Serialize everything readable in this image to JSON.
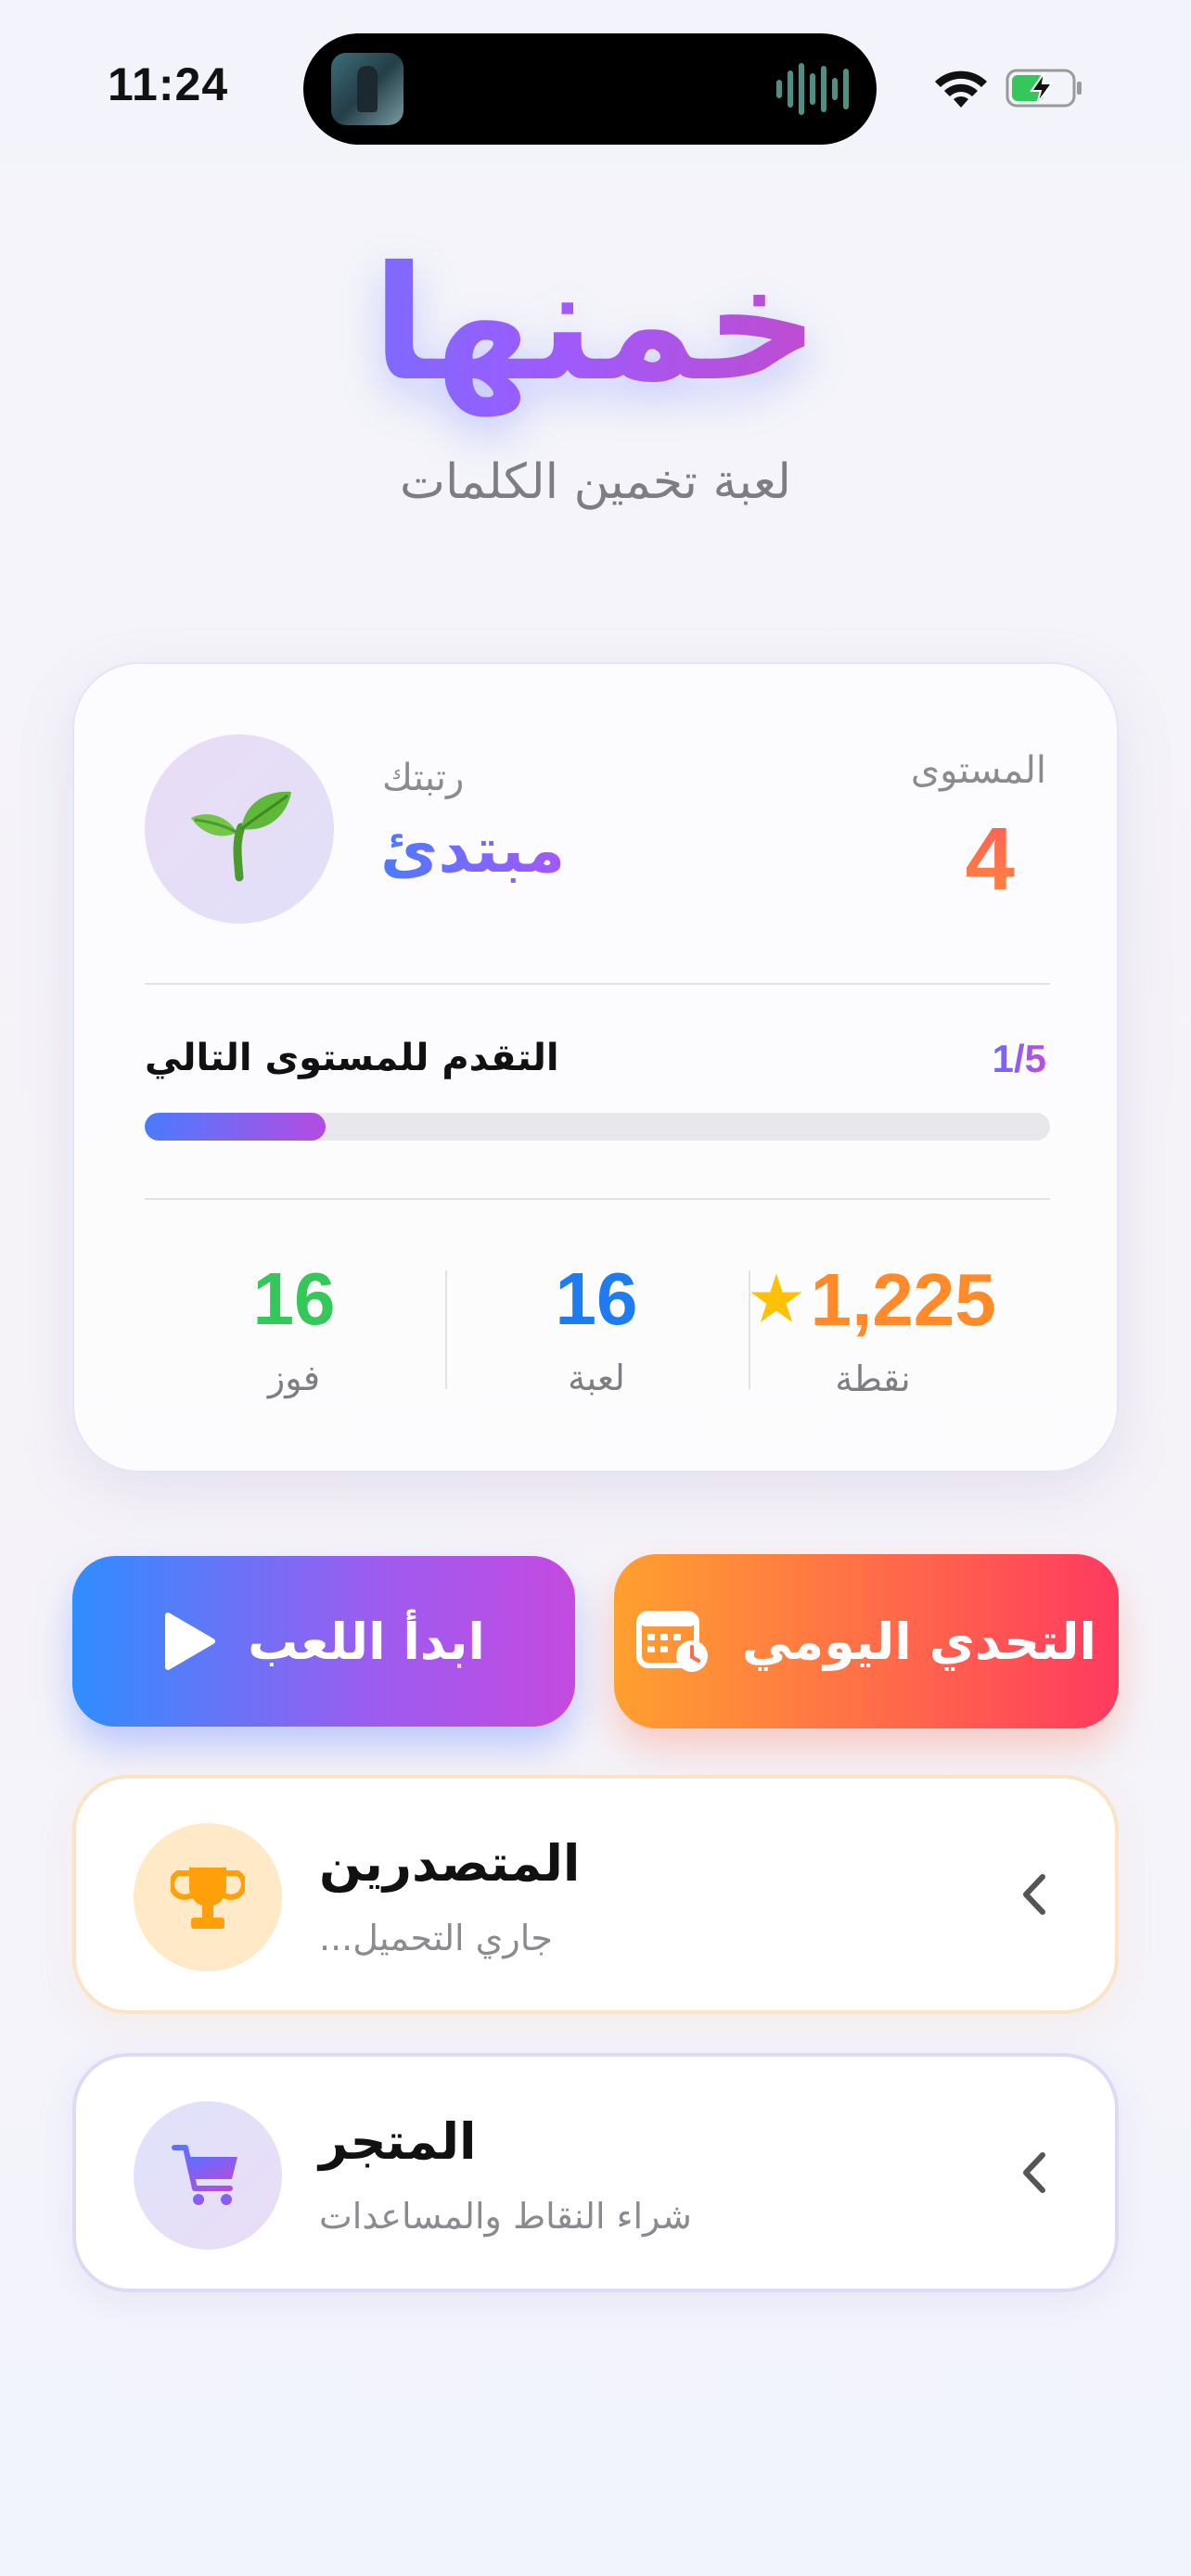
{
  "status_bar": {
    "time": "11:24",
    "icons": [
      "wifi-icon",
      "battery-charging-icon"
    ]
  },
  "header": {
    "title": "خمنها",
    "subtitle": "لعبة تخمين الكلمات"
  },
  "level_card": {
    "rank_caption": "رتبتك",
    "rank_value": "مبتدئ",
    "level_caption": "المستوى",
    "level_value": "4",
    "progress_label": "التقدم للمستوى التالي",
    "progress_count": "1/5",
    "progress_fraction": 0.2,
    "stats": {
      "points": {
        "value": "1,225",
        "label": "نقطة"
      },
      "games": {
        "value": "16",
        "label": "لعبة"
      },
      "wins": {
        "value": "16",
        "label": "فوز"
      }
    }
  },
  "actions": {
    "play_label": "ابدأ اللعب",
    "daily_label": "التحدي اليومي"
  },
  "leaderboard": {
    "title": "المتصدرين",
    "subtitle": "جاري التحميل..."
  },
  "store": {
    "title": "المتجر",
    "subtitle": "شراء النقاط والمساعدات"
  },
  "colors": {
    "points": "#ff8a2a",
    "games": "#1e7cf0",
    "wins": "#34c759"
  }
}
